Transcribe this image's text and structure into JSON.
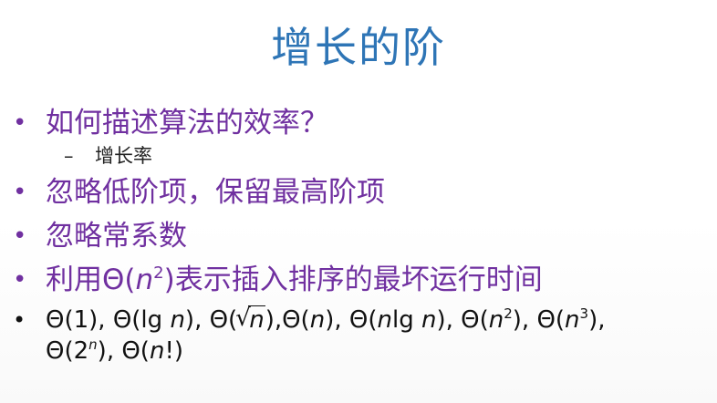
{
  "slide": {
    "title": "增长的阶",
    "bullets": [
      {
        "text": "如何描述算法的效率？",
        "sub": [
          "增长率"
        ]
      },
      {
        "text": "忽略低阶项，保留最高阶项"
      },
      {
        "text": "忽略常系数"
      },
      {
        "text_before": "利用",
        "theta": "Θ",
        "arg": "n",
        "exp": "2",
        "text_after": "表示插入排序的最坏运行时间"
      }
    ],
    "complexities": {
      "bullet_glyph": "•",
      "sub_glyph": "–",
      "line1": [
        "Θ(1), Θ(lg ",
        "n",
        "), Θ(",
        "√",
        "n",
        "),Θ(",
        "n",
        "), Θ(",
        "n",
        "lg ",
        "n",
        "), Θ(",
        "n",
        "2",
        "), Θ(",
        "n",
        "3",
        "),"
      ],
      "line2": [
        "Θ(2",
        "n",
        "), Θ(",
        "n",
        "!)"
      ]
    },
    "colors": {
      "title": "#2e75b6",
      "bullet_text": "#7030a0",
      "body_text": "#111111"
    }
  }
}
